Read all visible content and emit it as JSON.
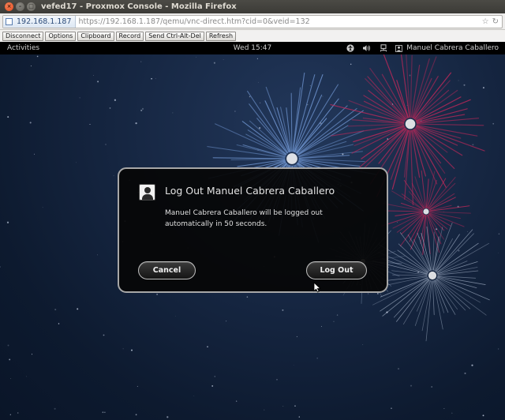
{
  "window": {
    "title": "vefed17 - Proxmox Console - Mozilla Firefox",
    "close_glyph": "×",
    "min_glyph": "–",
    "max_glyph": "□"
  },
  "urlbar": {
    "site_identity": "192.168.1.187",
    "url": "https://192.168.1.187/qemu/vnc-direct.htm?cid=0&veid=132",
    "star_glyph": "☆",
    "reload_glyph": "↻"
  },
  "vnc_toolbar": {
    "buttons": [
      "Disconnect",
      "Options",
      "Clipboard",
      "Record",
      "Send Ctrl-Alt-Del",
      "Refresh"
    ]
  },
  "gnome_bar": {
    "activities": "Activities",
    "clock": "Wed 15:47",
    "user": "Manuel Cabrera Caballero",
    "icons": [
      "accessibility-icon",
      "volume-icon",
      "network-icon",
      "user-icon"
    ]
  },
  "dialog": {
    "title": "Log Out Manuel Cabrera Caballero",
    "message": "Manuel Cabrera Caballero will be logged out automatically in 50 seconds.",
    "cancel_label": "Cancel",
    "logout_label": "Log Out"
  },
  "colors": {
    "desktop_bg": "#152540",
    "firework_blue": "#7fa8e8",
    "firework_magenta": "#c8285a",
    "dialog_bg": "#060606",
    "dialog_border": "#a7a7a7"
  }
}
